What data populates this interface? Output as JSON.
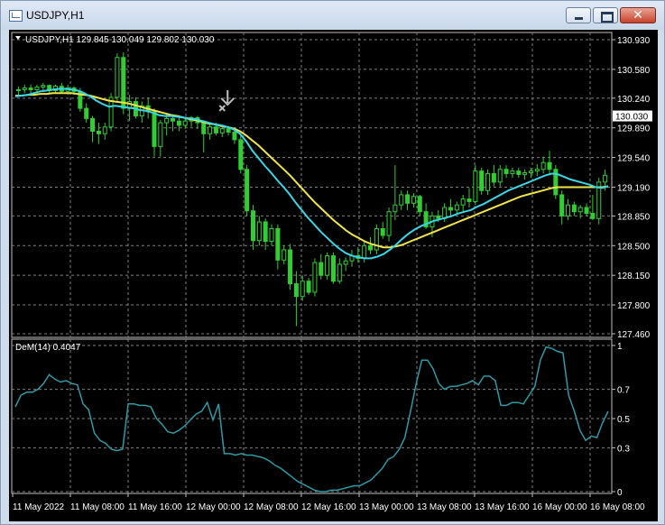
{
  "window": {
    "title": "USDJPY,H1",
    "close_glyph": "✕"
  },
  "colors": {
    "background": "#000000",
    "grid": "#7f7f7f",
    "candle_bull": "#32cd32",
    "candle_bear": "#32cd32",
    "ma_fast": "#38d6e6",
    "ma_slow": "#f0e44a",
    "dem": "#2e9aa6",
    "price_tag_bg": "#ffffff",
    "text": "#ffffff"
  },
  "price_panel": {
    "header": "USDJPY,H1  129.845 130.049 129.802 130.030",
    "current_price": "130.030",
    "y_ticks": [
      "130.930",
      "130.580",
      "130.240",
      "129.890",
      "129.540",
      "129.190",
      "128.850",
      "128.500",
      "128.150",
      "127.800",
      "127.460"
    ],
    "marker_icon": "sell-arrow-icon"
  },
  "indicator_panel": {
    "header": "DeM(14) 0.4047",
    "y_ticks": [
      "1",
      "0.7",
      "0.5",
      "0.3",
      "0"
    ]
  },
  "time_axis": {
    "labels": [
      "11 May 2022",
      "11 May 08:00",
      "11 May 16:00",
      "12 May 00:00",
      "12 May 08:00",
      "12 May 16:00",
      "13 May 00:00",
      "13 May 08:00",
      "13 May 16:00",
      "16 May 00:00",
      "16 May 08:00"
    ]
  },
  "chart_data": {
    "type": "candlestick",
    "symbol": "USDJPY",
    "timeframe": "H1",
    "ylim": [
      127.46,
      130.93
    ],
    "candles": [
      [
        130.33,
        130.38,
        130.28,
        130.34
      ],
      [
        130.34,
        130.4,
        130.3,
        130.36
      ],
      [
        130.36,
        130.4,
        130.3,
        130.34
      ],
      [
        130.34,
        130.4,
        130.3,
        130.37
      ],
      [
        130.37,
        130.42,
        130.33,
        130.39
      ],
      [
        130.39,
        130.4,
        130.3,
        130.33
      ],
      [
        130.33,
        130.4,
        130.3,
        130.38
      ],
      [
        130.38,
        130.42,
        130.3,
        130.32
      ],
      [
        130.32,
        130.4,
        130.28,
        130.36
      ],
      [
        130.36,
        130.38,
        130.28,
        130.32
      ],
      [
        130.32,
        130.36,
        130.08,
        130.12
      ],
      [
        130.12,
        130.18,
        129.95,
        130.0
      ],
      [
        130.0,
        130.03,
        129.72,
        129.85
      ],
      [
        129.85,
        129.95,
        129.7,
        129.82
      ],
      [
        129.82,
        129.95,
        129.75,
        129.9
      ],
      [
        129.9,
        130.3,
        129.85,
        130.25
      ],
      [
        130.25,
        130.77,
        130.2,
        130.72
      ],
      [
        130.72,
        130.78,
        130.05,
        130.12
      ],
      [
        130.12,
        130.28,
        129.97,
        130.2
      ],
      [
        130.2,
        130.25,
        130.0,
        130.03
      ],
      [
        130.03,
        130.2,
        129.95,
        130.15
      ],
      [
        130.15,
        130.25,
        130.0,
        130.08
      ],
      [
        130.08,
        130.12,
        129.55,
        129.67
      ],
      [
        129.67,
        129.98,
        129.55,
        129.95
      ],
      [
        129.95,
        130.05,
        129.8,
        130.0
      ],
      [
        130.0,
        130.05,
        129.85,
        129.97
      ],
      [
        129.97,
        130.02,
        129.85,
        129.92
      ],
      [
        129.92,
        130.02,
        129.88,
        129.97
      ],
      [
        129.97,
        130.03,
        129.9,
        130.01
      ],
      [
        130.01,
        130.03,
        129.88,
        129.95
      ],
      [
        129.95,
        129.98,
        129.6,
        129.82
      ],
      [
        129.82,
        129.93,
        129.75,
        129.9
      ],
      [
        129.9,
        129.95,
        129.8,
        129.83
      ],
      [
        129.83,
        129.92,
        129.78,
        129.88
      ],
      [
        129.88,
        129.91,
        129.8,
        129.84
      ],
      [
        129.84,
        129.9,
        129.7,
        129.75
      ],
      [
        129.75,
        129.8,
        129.35,
        129.4
      ],
      [
        129.4,
        129.45,
        128.85,
        128.91
      ],
      [
        128.91,
        128.98,
        128.45,
        128.56
      ],
      [
        128.56,
        128.85,
        128.5,
        128.78
      ],
      [
        128.78,
        128.82,
        128.45,
        128.55
      ],
      [
        128.55,
        128.75,
        128.5,
        128.7
      ],
      [
        128.7,
        128.75,
        128.22,
        128.33
      ],
      [
        128.33,
        128.5,
        128.28,
        128.45
      ],
      [
        128.45,
        128.52,
        127.98,
        128.05
      ],
      [
        128.05,
        128.2,
        127.55,
        127.9
      ],
      [
        127.9,
        128.15,
        127.85,
        128.08
      ],
      [
        128.08,
        128.12,
        127.92,
        127.95
      ],
      [
        127.95,
        128.35,
        127.9,
        128.3
      ],
      [
        128.3,
        128.4,
        128.1,
        128.15
      ],
      [
        128.15,
        128.42,
        128.1,
        128.38
      ],
      [
        128.38,
        128.42,
        128.05,
        128.08
      ],
      [
        128.08,
        128.35,
        128.05,
        128.28
      ],
      [
        128.28,
        128.36,
        128.2,
        128.32
      ],
      [
        128.32,
        128.45,
        128.25,
        128.38
      ],
      [
        128.38,
        128.48,
        128.3,
        128.35
      ],
      [
        128.35,
        128.55,
        128.3,
        128.5
      ],
      [
        128.5,
        128.6,
        128.4,
        128.45
      ],
      [
        128.45,
        128.75,
        128.4,
        128.7
      ],
      [
        128.7,
        128.78,
        128.58,
        128.62
      ],
      [
        128.62,
        128.95,
        128.55,
        128.9
      ],
      [
        128.9,
        129.45,
        128.8,
        128.98
      ],
      [
        128.98,
        129.15,
        128.92,
        129.1
      ],
      [
        129.1,
        129.15,
        128.92,
        129.0
      ],
      [
        129.0,
        129.12,
        128.95,
        129.08
      ],
      [
        129.08,
        129.1,
        128.85,
        128.9
      ],
      [
        128.9,
        129.0,
        128.7,
        128.72
      ],
      [
        128.72,
        128.9,
        128.6,
        128.85
      ],
      [
        128.85,
        128.92,
        128.78,
        128.82
      ],
      [
        128.82,
        129.0,
        128.78,
        128.95
      ],
      [
        128.95,
        129.05,
        128.85,
        128.92
      ],
      [
        128.92,
        129.02,
        128.88,
        128.98
      ],
      [
        128.98,
        129.1,
        128.9,
        129.05
      ],
      [
        129.05,
        129.18,
        128.95,
        129.02
      ],
      [
        129.02,
        129.45,
        128.98,
        129.38
      ],
      [
        129.38,
        129.42,
        129.1,
        129.15
      ],
      [
        129.15,
        129.4,
        129.1,
        129.35
      ],
      [
        129.35,
        129.45,
        129.2,
        129.25
      ],
      [
        129.25,
        129.45,
        129.2,
        129.4
      ],
      [
        129.4,
        129.45,
        129.3,
        129.35
      ],
      [
        129.35,
        129.42,
        129.3,
        129.38
      ],
      [
        129.38,
        129.42,
        129.3,
        129.34
      ],
      [
        129.34,
        129.4,
        129.28,
        129.36
      ],
      [
        129.36,
        129.42,
        129.3,
        129.38
      ],
      [
        129.38,
        129.46,
        129.32,
        129.4
      ],
      [
        129.4,
        129.55,
        129.35,
        129.48
      ],
      [
        129.48,
        129.62,
        129.35,
        129.4
      ],
      [
        129.4,
        129.45,
        129.05,
        129.1
      ],
      [
        129.1,
        129.15,
        128.75,
        128.85
      ],
      [
        128.85,
        129.05,
        128.8,
        128.98
      ],
      [
        128.98,
        129.02,
        128.85,
        128.9
      ],
      [
        128.9,
        128.98,
        128.82,
        128.95
      ],
      [
        128.95,
        129.0,
        128.85,
        128.88
      ],
      [
        128.88,
        129.1,
        128.8,
        128.82
      ],
      [
        128.82,
        129.3,
        128.75,
        129.25
      ],
      [
        129.25,
        129.4,
        129.15,
        129.33
      ]
    ],
    "ma_fast": [
      130.26,
      130.27,
      130.28,
      130.3,
      130.32,
      130.33,
      130.34,
      130.35,
      130.35,
      130.34,
      130.33,
      130.3,
      130.26,
      130.21,
      130.17,
      130.14,
      130.15,
      130.14,
      130.13,
      130.12,
      130.1,
      130.09,
      130.07,
      130.04,
      130.03,
      130.03,
      130.02,
      130.01,
      130.0,
      129.99,
      129.97,
      129.95,
      129.93,
      129.92,
      129.9,
      129.87,
      129.82,
      129.73,
      129.62,
      129.53,
      129.44,
      129.36,
      129.27,
      129.19,
      129.1,
      129.0,
      128.91,
      128.82,
      128.74,
      128.66,
      128.59,
      128.52,
      128.46,
      128.41,
      128.38,
      128.36,
      128.35,
      128.35,
      128.37,
      128.4,
      128.45,
      128.51,
      128.58,
      128.64,
      128.69,
      128.73,
      128.76,
      128.79,
      128.81,
      128.83,
      128.85,
      128.88,
      128.9,
      128.92,
      128.96,
      128.99,
      129.03,
      129.07,
      129.11,
      129.15,
      129.18,
      129.21,
      129.24,
      129.27,
      129.3,
      129.33,
      129.35,
      129.34,
      129.31,
      129.28,
      129.26,
      129.24,
      129.22,
      129.19,
      129.18,
      129.2
    ],
    "ma_slow": [
      130.27,
      130.27,
      130.28,
      130.28,
      130.29,
      130.29,
      130.3,
      130.3,
      130.3,
      130.3,
      130.29,
      130.28,
      130.27,
      130.25,
      130.23,
      130.21,
      130.2,
      130.19,
      130.18,
      130.16,
      130.14,
      130.12,
      130.1,
      130.08,
      130.06,
      130.04,
      130.03,
      130.01,
      129.99,
      129.98,
      129.96,
      129.94,
      129.93,
      129.91,
      129.9,
      129.88,
      129.85,
      129.8,
      129.74,
      129.68,
      129.61,
      129.54,
      129.47,
      129.4,
      129.33,
      129.25,
      129.17,
      129.09,
      129.01,
      128.94,
      128.87,
      128.8,
      128.74,
      128.68,
      128.63,
      128.59,
      128.55,
      128.52,
      128.5,
      128.48,
      128.48,
      128.49,
      128.51,
      128.54,
      128.57,
      128.6,
      128.63,
      128.66,
      128.69,
      128.72,
      128.75,
      128.78,
      128.81,
      128.84,
      128.87,
      128.9,
      128.93,
      128.96,
      128.99,
      129.02,
      129.05,
      129.08,
      129.1,
      129.12,
      129.14,
      129.16,
      129.18,
      129.19,
      129.19,
      129.19,
      129.19,
      129.19,
      129.19,
      129.19,
      129.19,
      129.2
    ],
    "dem": [
      0.58,
      0.66,
      0.68,
      0.68,
      0.7,
      0.74,
      0.8,
      0.77,
      0.75,
      0.76,
      0.74,
      0.73,
      0.6,
      0.56,
      0.4,
      0.35,
      0.33,
      0.29,
      0.28,
      0.29,
      0.6,
      0.6,
      0.59,
      0.59,
      0.58,
      0.5,
      0.46,
      0.41,
      0.4,
      0.42,
      0.45,
      0.49,
      0.53,
      0.55,
      0.61,
      0.49,
      0.6,
      0.26,
      0.26,
      0.25,
      0.26,
      0.25,
      0.25,
      0.24,
      0.23,
      0.21,
      0.18,
      0.16,
      0.13,
      0.1,
      0.07,
      0.05,
      0.03,
      0.01,
      0.0,
      0.0,
      0.01,
      0.01,
      0.02,
      0.03,
      0.04,
      0.04,
      0.06,
      0.08,
      0.12,
      0.16,
      0.22,
      0.24,
      0.29,
      0.37,
      0.55,
      0.74,
      0.9,
      0.9,
      0.84,
      0.74,
      0.7,
      0.72,
      0.72,
      0.73,
      0.74,
      0.76,
      0.73,
      0.79,
      0.79,
      0.76,
      0.59,
      0.59,
      0.61,
      0.61,
      0.6,
      0.66,
      0.72,
      0.9,
      0.99,
      0.98,
      0.96,
      0.95,
      0.66,
      0.55,
      0.42,
      0.35,
      0.38,
      0.37,
      0.47,
      0.55
    ],
    "dem_ylim": [
      0,
      1
    ],
    "marker": {
      "type": "sell",
      "index": 33,
      "price": 130.1
    }
  }
}
